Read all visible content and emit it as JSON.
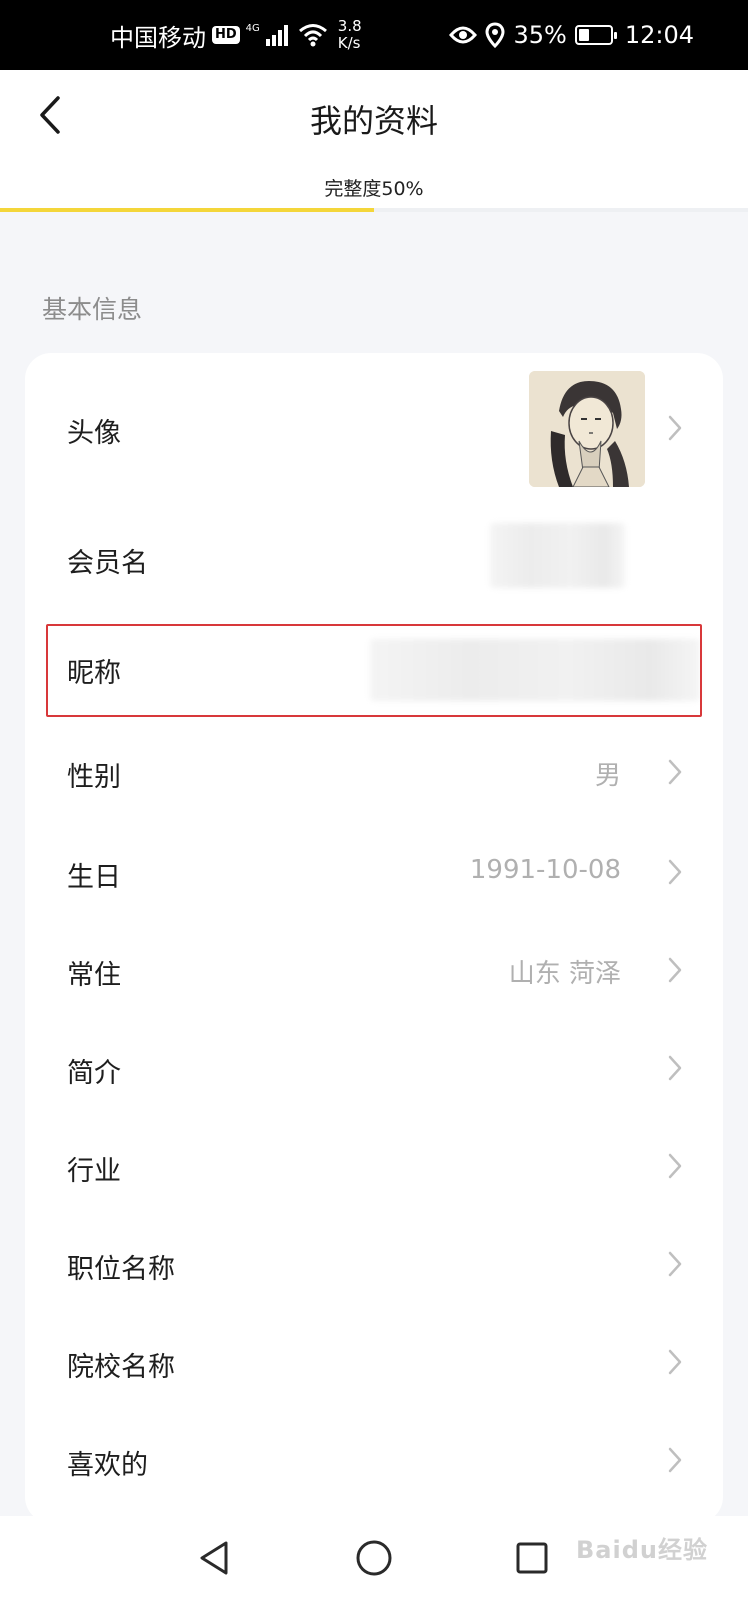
{
  "status_bar": {
    "carrier": "中国移动",
    "hd_badge": "HD",
    "network": "4G",
    "speed_value": "3.8",
    "speed_unit": "K/s",
    "battery_percent": "35%",
    "battery_level": 0.35,
    "time": "12:04"
  },
  "header": {
    "title": "我的资料",
    "completeness_label": "完整度50%",
    "completeness_value": 0.5
  },
  "section": {
    "title": "基本信息"
  },
  "rows": [
    {
      "label": "头像",
      "value": "",
      "type": "avatar"
    },
    {
      "label": "会员名",
      "value": "",
      "type": "blurred"
    },
    {
      "label": "昵称",
      "value": "",
      "type": "blurred"
    },
    {
      "label": "性别",
      "value": "男",
      "type": "link"
    },
    {
      "label": "生日",
      "value": "1991-10-08",
      "type": "link"
    },
    {
      "label": "常住",
      "value": "山东 菏泽",
      "type": "link"
    },
    {
      "label": "简介",
      "value": "",
      "type": "link"
    },
    {
      "label": "行业",
      "value": "",
      "type": "link"
    },
    {
      "label": "职位名称",
      "value": "",
      "type": "link"
    },
    {
      "label": "院校名称",
      "value": "",
      "type": "link"
    },
    {
      "label": "喜欢的",
      "value": "",
      "type": "link"
    }
  ],
  "watermark": "Baidu经验",
  "colors": {
    "progress": "#f4d63a",
    "highlight_border": "#d8383a",
    "background": "#f5f6f9"
  }
}
